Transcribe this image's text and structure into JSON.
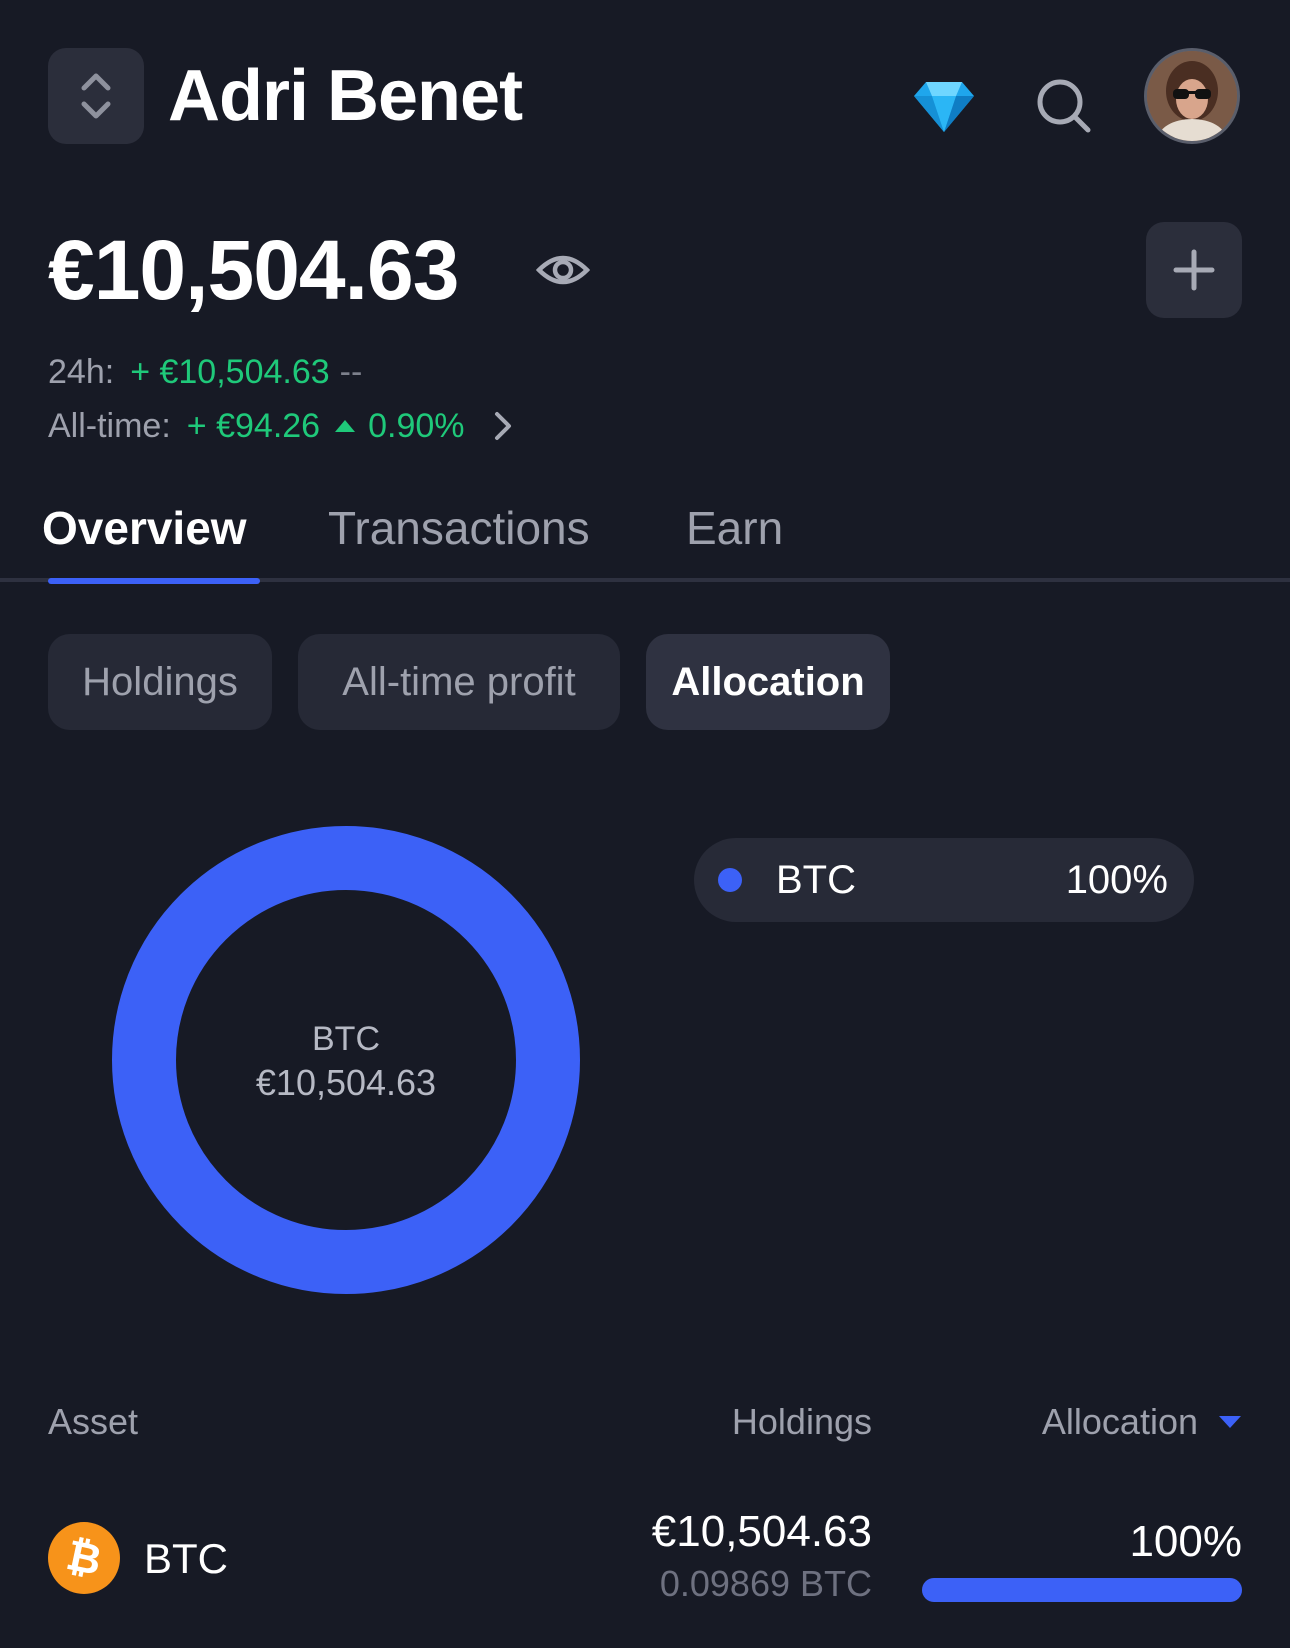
{
  "header": {
    "portfolio_name": "Adri Benet",
    "icons": [
      "chevron-updown-icon",
      "diamond-icon",
      "search-icon",
      "avatar"
    ]
  },
  "balance": {
    "total": "€10,504.63",
    "stats": {
      "day_label": "24h:",
      "day_value": "+ €10,504.63",
      "day_pct": "--",
      "alltime_label": "All-time:",
      "alltime_value": "+ €94.26",
      "alltime_pct": "0.90%"
    }
  },
  "tabs": [
    {
      "label": "Overview",
      "active": true
    },
    {
      "label": "Transactions",
      "active": false
    },
    {
      "label": "Earn",
      "active": false
    }
  ],
  "chips": [
    {
      "label": "Holdings",
      "active": false
    },
    {
      "label": "All-time profit",
      "active": false
    },
    {
      "label": "Allocation",
      "active": true
    }
  ],
  "chart_data": {
    "type": "pie",
    "variant": "donut",
    "center_label": "BTC",
    "center_value": "€10,504.63",
    "slices": [
      {
        "name": "BTC",
        "percent": 100,
        "label": "100%",
        "color": "#3c61f7"
      }
    ],
    "legend_placement": "right"
  },
  "table": {
    "headers": {
      "asset": "Asset",
      "holdings": "Holdings",
      "allocation": "Allocation"
    },
    "rows": [
      {
        "asset": "BTC",
        "value": "€10,504.63",
        "amount": "0.09869 BTC",
        "allocation": "100%",
        "allocation_fraction": 1.0
      }
    ]
  },
  "colors": {
    "background": "#171a25",
    "accent": "#3c61f7",
    "positive": "#1fc97a",
    "btc": "#f7931a"
  }
}
